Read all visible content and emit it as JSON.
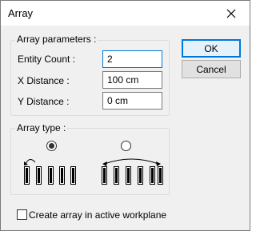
{
  "window": {
    "title": "Array",
    "close_icon": "close-icon"
  },
  "array_parameters": {
    "legend": "Array parameters :",
    "entity_count": {
      "label": "Entity Count :",
      "value": "2"
    },
    "x_distance": {
      "label": "X Distance :",
      "value": "100 cm"
    },
    "y_distance": {
      "label": "Y Distance :",
      "value": "0 cm"
    }
  },
  "buttons": {
    "ok": "OK",
    "cancel": "Cancel"
  },
  "array_type": {
    "legend": "Array type :",
    "options": [
      {
        "name": "sequential",
        "checked": true,
        "icon": "sequential-array-icon"
      },
      {
        "name": "fixed-span",
        "checked": false,
        "icon": "span-array-icon"
      }
    ]
  },
  "workplane": {
    "label": "Create array in active workplane",
    "checked": false
  },
  "colors": {
    "focus_accent": "#0078d7",
    "dialog_bg": "#f0f0f0"
  }
}
